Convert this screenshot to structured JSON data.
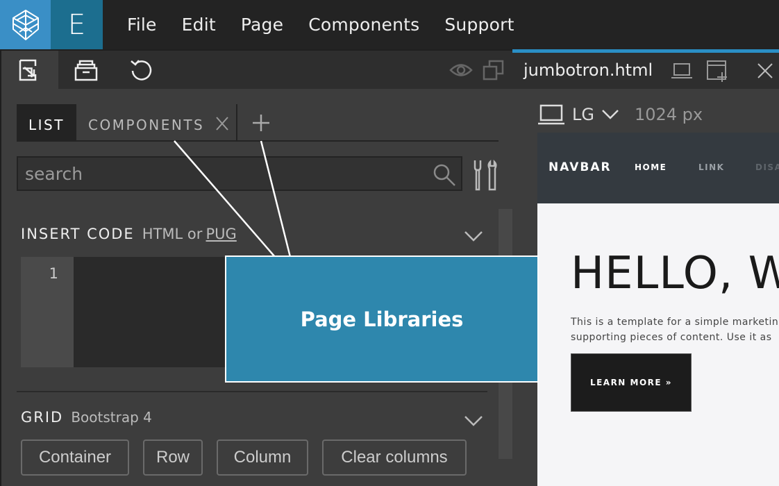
{
  "menu": {
    "items": [
      {
        "label": "File"
      },
      {
        "label": "Edit"
      },
      {
        "label": "Page"
      },
      {
        "label": "Components"
      },
      {
        "label": "Support"
      }
    ]
  },
  "brand": {
    "logo_letter": "E",
    "accent": "#3a8fc6",
    "secondary": "#1c6e8f"
  },
  "left_panel": {
    "tabs": {
      "list": "LIST",
      "components": "COMPONENTS"
    },
    "search": {
      "placeholder": "search"
    },
    "insert_code": {
      "title": "INSERT CODE",
      "subtitle": "HTML or",
      "pug": "PUG",
      "line_number": "1"
    },
    "grid": {
      "title": "GRID",
      "subtitle": "Bootstrap 4",
      "buttons": {
        "container": "Container",
        "row": "Row",
        "column": "Column",
        "clear": "Clear columns"
      }
    }
  },
  "right_panel": {
    "file_name": "jumbotron.html",
    "device_size": "LG",
    "device_px": "1024 px",
    "accent": "#2a8fc6",
    "site": {
      "brand": "NAVBAR",
      "nav": {
        "home": "HOME",
        "link": "LINK",
        "disabled": "DISA"
      },
      "hero_title": "HELLO, W",
      "hero_text_line1": "This is a template for a simple marketin",
      "hero_text_line2": "supporting pieces of content. Use it as",
      "hero_button": "LEARN MORE »"
    }
  },
  "callout": {
    "text": "Page Libraries",
    "color": "#2e87ad"
  },
  "icons": [
    "pinegrow-logo-icon",
    "import-icon",
    "library-icon",
    "refresh-icon",
    "eye-icon",
    "window-icon",
    "close-icon",
    "plus-icon",
    "search-icon",
    "tools-icon",
    "chevron-down-icon",
    "laptop-icon",
    "new-window-icon"
  ]
}
